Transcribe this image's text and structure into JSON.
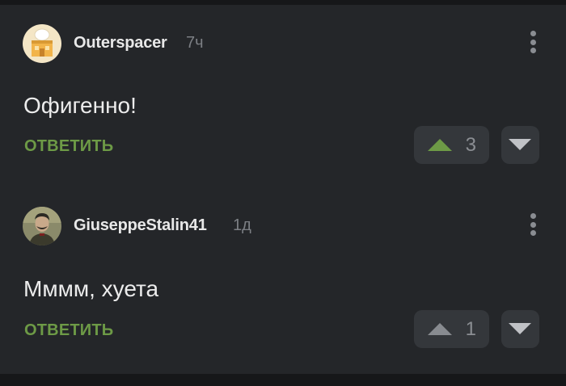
{
  "comments": [
    {
      "author": "Outerspacer",
      "time": "7ч",
      "text": "Офигенно!",
      "reply_label": "ОТВЕТИТЬ",
      "rating": "3",
      "upvoted": true,
      "avatar_icon": "building-avatar"
    },
    {
      "author": "GiuseppeStalin41",
      "time": "1д",
      "text": "Мммм, хуета",
      "reply_label": "ОТВЕТИТЬ",
      "rating": "1",
      "upvoted": false,
      "avatar_icon": "portrait-avatar"
    }
  ],
  "colors": {
    "background": "#242629",
    "accent_green": "#6d9a46",
    "button_bg": "#34373b"
  }
}
